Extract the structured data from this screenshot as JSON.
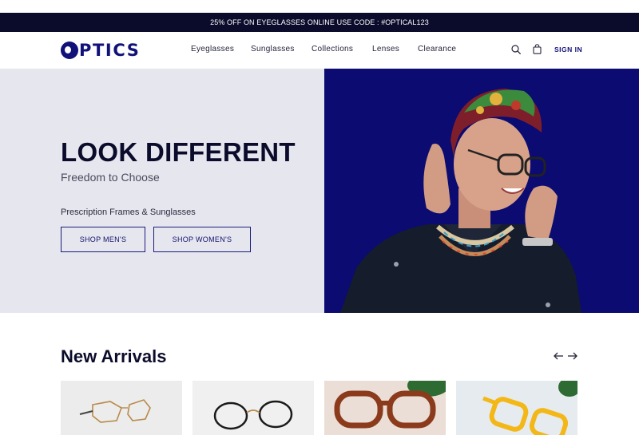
{
  "promo": {
    "text": "25% OFF ON EYEGLASSES ONLINE USE CODE : #OPTICAL123"
  },
  "header": {
    "logo_text": "PTICS",
    "nav": [
      "Eyeglasses",
      "Sunglasses",
      "Collections",
      "Lenses",
      "Clearance"
    ],
    "signin_label": "SIGN IN"
  },
  "hero": {
    "title": "LOOK DIFFERENT",
    "subtitle": "Freedom to Choose",
    "tagline": "Prescription Frames & Sunglasses",
    "buttons": {
      "men": "SHOP MEN'S",
      "women": "SHOP WOMEN'S"
    }
  },
  "new_arrivals": {
    "title": "New Arrivals"
  },
  "colors": {
    "brand": "#11117a",
    "promo_bg": "#0b0b2b",
    "hero_left_bg": "#e6e6ef",
    "hero_right_bg": "#0b0b72"
  }
}
